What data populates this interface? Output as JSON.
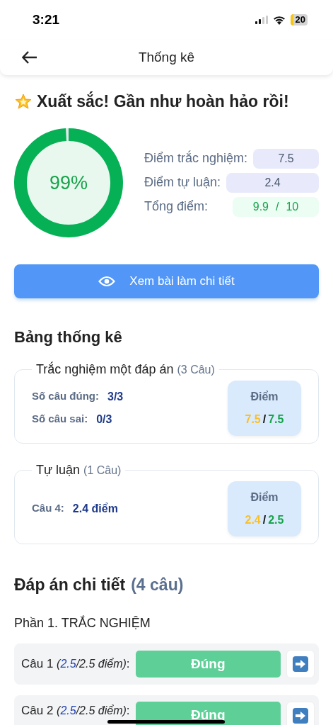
{
  "status_bar": {
    "time": "3:21",
    "battery": "20"
  },
  "header": {
    "title": "Thống kê"
  },
  "result": {
    "headline": "Xuất sắc! Gần như hoàn hảo rồi!",
    "percent": "99%",
    "level": 0.99,
    "stats": [
      {
        "label": "Điểm trắc nghiệm:",
        "kind": "plain",
        "value": "7.5"
      },
      {
        "label": "Điểm tự luận:",
        "kind": "plain",
        "value": "2.4"
      },
      {
        "label": "Tổng điểm:",
        "kind": "total",
        "value": "9.9",
        "separator": "/",
        "max": "10"
      }
    ]
  },
  "view_button": "Xem bài làm chi tiết",
  "summary": {
    "title": "Bảng thống kê",
    "groups": [
      {
        "title": "Trắc nghiệm một đáp án",
        "count": "(3 Câu)",
        "lines": [
          {
            "label": "Số câu đúng:",
            "value": "3/3"
          },
          {
            "label": "Số câu sai:",
            "value": "0/3"
          }
        ],
        "score": {
          "label": "Điểm",
          "got": "7.5",
          "separator": "/",
          "max": "7.5"
        }
      },
      {
        "title": "Tự luận",
        "count": "(1 Câu)",
        "lines": [
          {
            "label": "Câu 4:",
            "value": "2.4 điểm"
          }
        ],
        "score": {
          "label": "Điểm",
          "got": "2.4",
          "separator": "/",
          "max": "2.5"
        }
      }
    ]
  },
  "details": {
    "title": "Đáp án chi tiết",
    "count": "(4 câu)",
    "section": "Phần 1. TRẮC NGHIỆM",
    "questions": [
      {
        "label": "Câu 1",
        "open": "(",
        "got": "2.5",
        "rest": "/2.5 điểm)",
        "end": ":",
        "result": "Đúng",
        "kind": "correct"
      },
      {
        "label": "Câu 2",
        "open": "(",
        "got": "2.5",
        "rest": "/2.5 điểm)",
        "end": ":",
        "result": "Đúng",
        "kind": "correct"
      }
    ]
  }
}
